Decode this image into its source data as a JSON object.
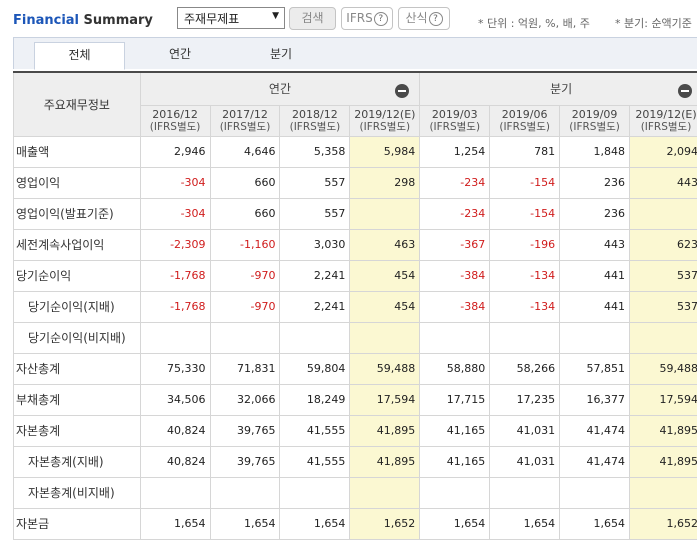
{
  "header": {
    "title_main": "Financial",
    "title_rest": " Summary",
    "select_value": "주재무제표",
    "search_label": "검색",
    "ifrs_label": "IFRS",
    "calc_label": "산식",
    "help_glyph": "?",
    "unit_note": "* 단위 : 억원, %, 배, 주",
    "quarter_note": "* 분기: 순액기준"
  },
  "tabs": [
    "전체",
    "연간",
    "분기"
  ],
  "table": {
    "corner_label": "주요재무정보",
    "annual_label": "연간",
    "quarter_label": "분기",
    "columns": [
      {
        "period": "2016/12",
        "sub": "(IFRS별도)"
      },
      {
        "period": "2017/12",
        "sub": "(IFRS별도)"
      },
      {
        "period": "2018/12",
        "sub": "(IFRS별도)"
      },
      {
        "period": "2019/12(E)",
        "sub": "(IFRS별도)"
      },
      {
        "period": "2019/03",
        "sub": "(IFRS별도)"
      },
      {
        "period": "2019/06",
        "sub": "(IFRS별도)"
      },
      {
        "period": "2019/09",
        "sub": "(IFRS별도)"
      },
      {
        "period": "2019/12(E)",
        "sub": "(IFRS별도)"
      }
    ],
    "rows": [
      {
        "label": "매출액",
        "indent": false,
        "values": [
          "2,946",
          "4,646",
          "5,358",
          "5,984",
          "1,254",
          "781",
          "1,848",
          "2,094"
        ]
      },
      {
        "label": "영업이익",
        "indent": false,
        "values": [
          "-304",
          "660",
          "557",
          "298",
          "-234",
          "-154",
          "236",
          "443"
        ]
      },
      {
        "label": "영업이익(발표기준)",
        "indent": false,
        "values": [
          "-304",
          "660",
          "557",
          "",
          "-234",
          "-154",
          "236",
          ""
        ]
      },
      {
        "label": "세전계속사업이익",
        "indent": false,
        "values": [
          "-2,309",
          "-1,160",
          "3,030",
          "463",
          "-367",
          "-196",
          "443",
          "623"
        ]
      },
      {
        "label": "당기순이익",
        "indent": false,
        "values": [
          "-1,768",
          "-970",
          "2,241",
          "454",
          "-384",
          "-134",
          "441",
          "537"
        ]
      },
      {
        "label": "당기순이익(지배)",
        "indent": true,
        "values": [
          "-1,768",
          "-970",
          "2,241",
          "454",
          "-384",
          "-134",
          "441",
          "537"
        ]
      },
      {
        "label": "당기순이익(비지배)",
        "indent": true,
        "values": [
          "",
          "",
          "",
          "",
          "",
          "",
          "",
          ""
        ]
      },
      {
        "label": "자산총계",
        "indent": false,
        "values": [
          "75,330",
          "71,831",
          "59,804",
          "59,488",
          "58,880",
          "58,266",
          "57,851",
          "59,488"
        ]
      },
      {
        "label": "부채총계",
        "indent": false,
        "values": [
          "34,506",
          "32,066",
          "18,249",
          "17,594",
          "17,715",
          "17,235",
          "16,377",
          "17,594"
        ]
      },
      {
        "label": "자본총계",
        "indent": false,
        "values": [
          "40,824",
          "39,765",
          "41,555",
          "41,895",
          "41,165",
          "41,031",
          "41,474",
          "41,895"
        ]
      },
      {
        "label": "자본총계(지배)",
        "indent": true,
        "values": [
          "40,824",
          "39,765",
          "41,555",
          "41,895",
          "41,165",
          "41,031",
          "41,474",
          "41,895"
        ]
      },
      {
        "label": "자본총계(비지배)",
        "indent": true,
        "values": [
          "",
          "",
          "",
          "",
          "",
          "",
          "",
          ""
        ]
      },
      {
        "label": "자본금",
        "indent": false,
        "values": [
          "1,654",
          "1,654",
          "1,654",
          "1,652",
          "1,654",
          "1,654",
          "1,654",
          "1,652"
        ]
      }
    ]
  },
  "colors": {
    "title_blue": "#1c56b8",
    "negative": "#d01c1c",
    "estimate_bg": "#fbf8d2",
    "header_bg": "#eeeeee"
  }
}
